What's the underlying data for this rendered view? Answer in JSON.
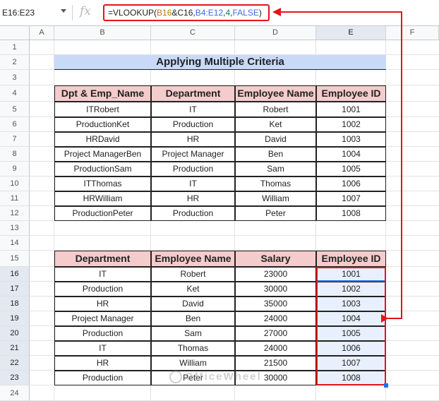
{
  "formula_bar": {
    "name_box": "E16:E23",
    "fx": "fx",
    "formula_parts": [
      {
        "t": "=VLOOKUP(",
        "c": ""
      },
      {
        "t": "B16",
        "c": "orange"
      },
      {
        "t": "&C16,",
        "c": ""
      },
      {
        "t": "B4:E12",
        "c": "blue"
      },
      {
        "t": ",",
        "c": ""
      },
      {
        "t": "4",
        "c": "green"
      },
      {
        "t": ",",
        "c": ""
      },
      {
        "t": "FALSE",
        "c": "blue"
      },
      {
        "t": ")",
        "c": ""
      }
    ]
  },
  "columns": [
    "A",
    "B",
    "C",
    "D",
    "E",
    "F"
  ],
  "rows": [
    "1",
    "2",
    "3",
    "4",
    "5",
    "6",
    "7",
    "8",
    "9",
    "10",
    "11",
    "12",
    "13",
    "14",
    "15",
    "16",
    "17",
    "18",
    "19",
    "20",
    "21",
    "22",
    "23",
    "24"
  ],
  "title": "Applying Multiple Criteria",
  "table1": {
    "headers": [
      "Dpt & Emp_Name",
      "Department",
      "Employee Name",
      "Employee ID"
    ],
    "rows": [
      [
        "ITRobert",
        "IT",
        "Robert",
        "1001"
      ],
      [
        "ProductionKet",
        "Production",
        "Ket",
        "1002"
      ],
      [
        "HRDavid",
        "HR",
        "David",
        "1003"
      ],
      [
        "Project ManagerBen",
        "Project Manager",
        "Ben",
        "1004"
      ],
      [
        "ProductionSam",
        "Production",
        "Sam",
        "1005"
      ],
      [
        "ITThomas",
        "IT",
        "Thomas",
        "1006"
      ],
      [
        "HRWilliam",
        "HR",
        "William",
        "1007"
      ],
      [
        "ProductionPeter",
        "Production",
        "Peter",
        "1008"
      ]
    ]
  },
  "table2": {
    "headers": [
      "Department",
      "Employee Name",
      "Salary",
      "Employee ID"
    ],
    "rows": [
      [
        "IT",
        "Robert",
        "23000",
        "1001"
      ],
      [
        "Production",
        "Ket",
        "30000",
        "1002"
      ],
      [
        "HR",
        "David",
        "35000",
        "1003"
      ],
      [
        "Project Manager",
        "Ben",
        "24000",
        "1004"
      ],
      [
        "Production",
        "Sam",
        "27000",
        "1005"
      ],
      [
        "IT",
        "Thomas",
        "24000",
        "1006"
      ],
      [
        "HR",
        "William",
        "21500",
        "1007"
      ],
      [
        "Production",
        "Peter",
        "30000",
        "1008"
      ]
    ]
  },
  "watermark": "OfficeWheel",
  "colors": {
    "accent_red": "#e3151a",
    "header_fill": "#f4cccc",
    "title_fill": "#c9daf8",
    "selection_blue": "#1a73e8"
  }
}
